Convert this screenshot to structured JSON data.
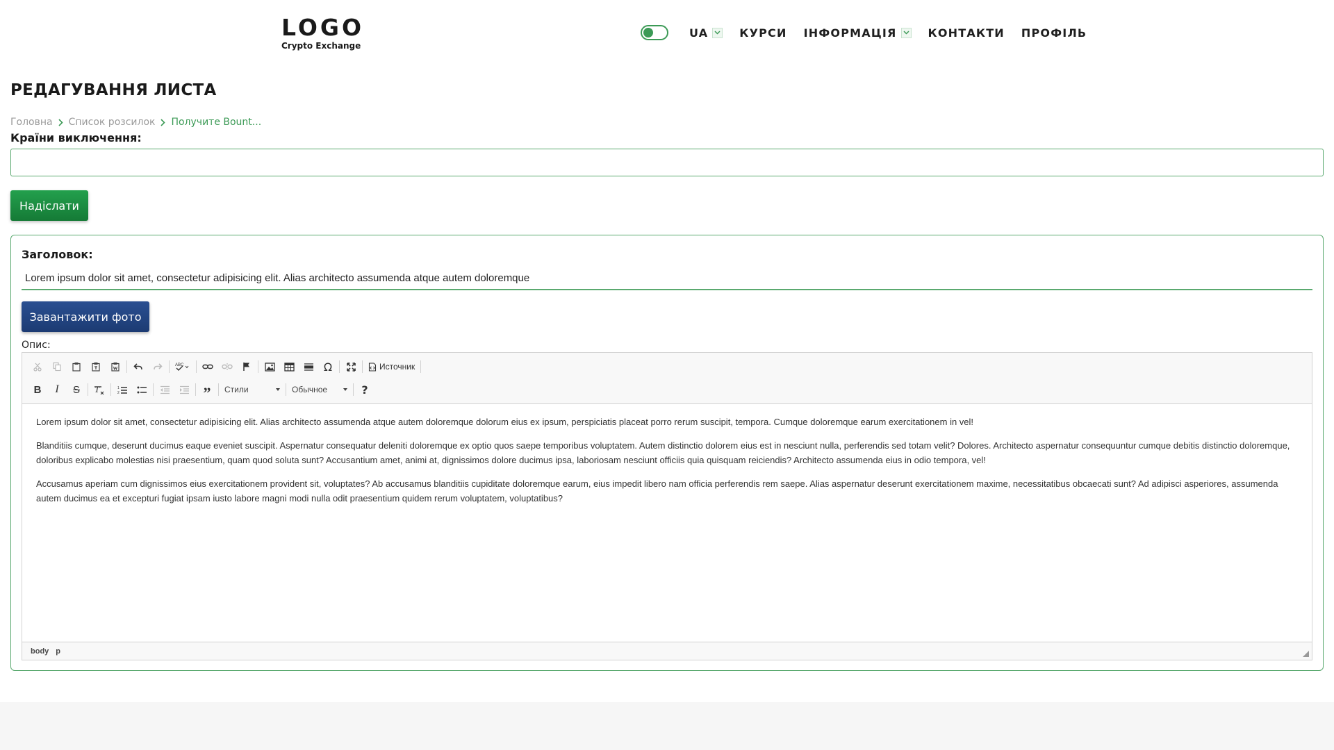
{
  "header": {
    "logo_main": "LOGO",
    "logo_sub": "Crypto Exchange",
    "lang": "UA",
    "nav": [
      {
        "label": "КУРСИ"
      },
      {
        "label": "ІНФОРМАЦІЯ"
      },
      {
        "label": "КОНТАКТИ"
      },
      {
        "label": "ПРОФІЛЬ"
      }
    ]
  },
  "page": {
    "title": "РЕДАГУВАННЯ ЛИСТА",
    "breadcrumb": [
      "Головна",
      "Список розсилок",
      "Получите Bount..."
    ]
  },
  "form": {
    "countries_label": "Країни виключення:",
    "countries_value": "",
    "send_label": "Надіслати",
    "title_label": "Заголовок:",
    "title_value": "Lorem ipsum dolor sit amet, consectetur adipisicing elit. Alias architecto assumenda atque autem doloremque",
    "upload_label": "Завантажити фото",
    "desc_label": "Опис:"
  },
  "editor": {
    "source_label": "Источник",
    "styles_label": "Стили",
    "format_label": "Обычное",
    "paragraphs": [
      "Lorem ipsum dolor sit amet, consectetur adipisicing elit. Alias architecto assumenda atque autem doloremque dolorum eius ex ipsum, perspiciatis placeat porro rerum suscipit, tempora. Cumque doloremque earum exercitationem in vel!",
      "Blanditiis cumque, deserunt ducimus eaque eveniet suscipit. Aspernatur consequatur deleniti doloremque ex optio quos saepe temporibus voluptatem. Autem distinctio dolorem eius est in nesciunt nulla, perferendis sed totam velit? Dolores. Architecto aspernatur consequuntur cumque debitis distinctio doloremque, doloribus explicabo molestias nisi praesentium, quam quod soluta sunt? Accusantium amet, animi at, dignissimos dolore ducimus ipsa, laboriosam nesciunt officiis quia quisquam reiciendis? Architecto assumenda eius in odio tempora, vel!",
      "Accusamus aperiam cum dignissimos eius exercitationem provident sit, voluptates? Ab accusamus blanditiis cupiditate doloremque earum, eius impedit libero nam officia perferendis rem saepe. Alias aspernatur deserunt exercitationem maxime, necessitatibus obcaecati sunt? Ad adipisci asperiores, assumenda autem ducimus ea et excepturi fugiat ipsam iusto labore magni modi nulla odit praesentium quidem rerum voluptatem, voluptatibus?"
    ],
    "status_path": [
      "body",
      "p"
    ]
  },
  "colors": {
    "accent_green": "#3c9a56",
    "send_button": "#1e8e42",
    "upload_button": "#24467f"
  }
}
